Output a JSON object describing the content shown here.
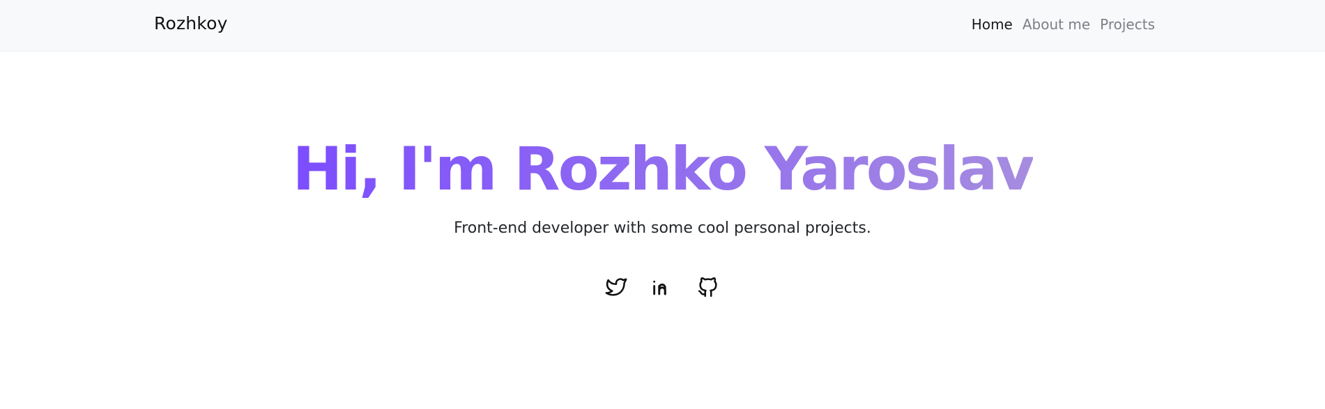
{
  "navbar": {
    "brand": "Rozhkoy",
    "links": [
      {
        "label": "Home",
        "active": true
      },
      {
        "label": "About me",
        "active": false
      },
      {
        "label": "Projects",
        "active": false
      }
    ]
  },
  "hero": {
    "title": "Hi, I'm Rozhko Yaroslav",
    "subtitle": "Front-end developer with some cool personal projects.",
    "gradient": {
      "start": "#7c4dff",
      "end": "#a68ce0"
    }
  },
  "socials": [
    {
      "icon": "twitter-icon"
    },
    {
      "icon": "linkedin-icon"
    },
    {
      "icon": "github-icon"
    }
  ]
}
